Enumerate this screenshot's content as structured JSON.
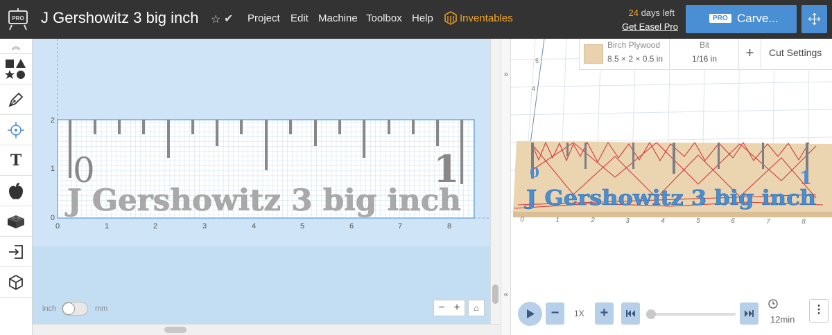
{
  "header": {
    "pro_badge": "PRO",
    "title": "J Gershowitz 3 big inch",
    "menu": [
      "Project",
      "Edit",
      "Machine",
      "Toolbox",
      "Help"
    ],
    "brand": "Inventables",
    "trial_days": "24",
    "trial_suffix": " days left",
    "trial_link": "Get Easel Pro",
    "carve_badge": "PRO",
    "carve_label": "Carve...",
    "accent_color": "#f5a623",
    "carve_color": "#4a8ed3"
  },
  "toolbar": {
    "tools": [
      "shapes-icon",
      "pen-icon",
      "target-icon",
      "text-icon",
      "apple-icon",
      "apps-icon",
      "import-icon",
      "cube-icon"
    ]
  },
  "design": {
    "x_ticks": [
      "0",
      "1",
      "2",
      "3",
      "4",
      "5",
      "6",
      "7",
      "8"
    ],
    "y_ticks": [
      "0",
      "1",
      "2"
    ],
    "ruler_digit_left": "0",
    "ruler_digit_right": "1",
    "engraved_text": "J Gershowitz 3 big inch",
    "unit_left": "inch",
    "unit_right": "mm",
    "zoom_out": "−",
    "zoom_in": "+"
  },
  "preview": {
    "material_name": "Birch Plywood",
    "material_size": "8.5 × 2 × 0.5 in",
    "bit_title": "Bit",
    "bit_value": "1/16 in",
    "cut_settings": "Cut Settings",
    "add": "+",
    "x_ticks": [
      "0",
      "1",
      "2",
      "3",
      "4",
      "5",
      "6",
      "7",
      "8"
    ],
    "y_ticks": [
      "4",
      "5"
    ],
    "preview_digit_left": "0",
    "preview_digit_right": "1",
    "preview_text": "J Gershowitz 3 big inch",
    "speed": "1X",
    "time": "12min"
  }
}
